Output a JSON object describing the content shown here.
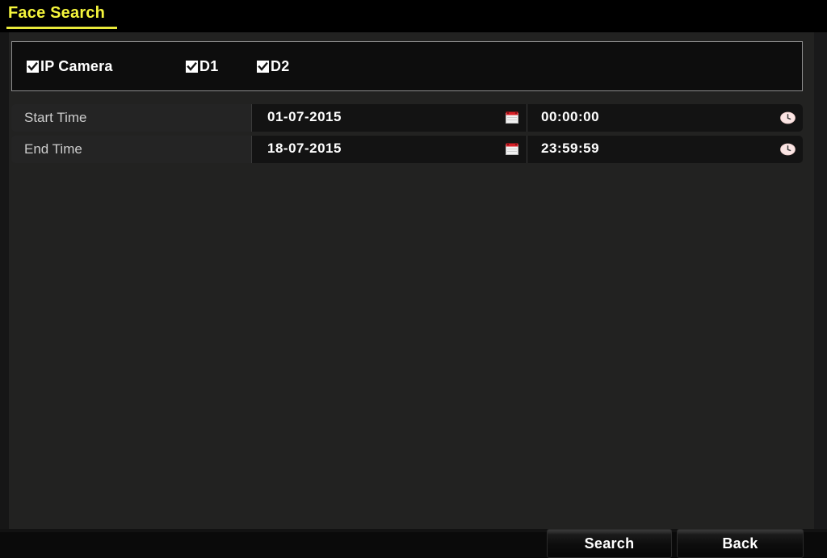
{
  "window": {
    "title": "Face Search"
  },
  "camera_panel": {
    "items": [
      {
        "label": "IP Camera",
        "checked": true,
        "icon": "checkbox-checked-icon"
      },
      {
        "label": "D1",
        "checked": true,
        "icon": "checkbox-checked-icon"
      },
      {
        "label": "D2",
        "checked": true,
        "icon": "checkbox-checked-icon"
      }
    ]
  },
  "time_filter": {
    "rows": [
      {
        "label": "Start Time",
        "date": "01-07-2015",
        "time": "00:00:00",
        "date_icon": "calendar-icon",
        "time_icon": "clock-icon"
      },
      {
        "label": "End Time",
        "date": "18-07-2015",
        "time": "23:59:59",
        "date_icon": "calendar-icon",
        "time_icon": "clock-icon"
      }
    ]
  },
  "footer": {
    "search_label": "Search",
    "back_label": "Back"
  },
  "colors": {
    "title_yellow": "#f5f53c",
    "panel_background": "#222221",
    "field_background": "#131313",
    "calendar_red": "#d81f26",
    "text_white": "#ffffff",
    "label_gray": "#cdcdcd"
  }
}
